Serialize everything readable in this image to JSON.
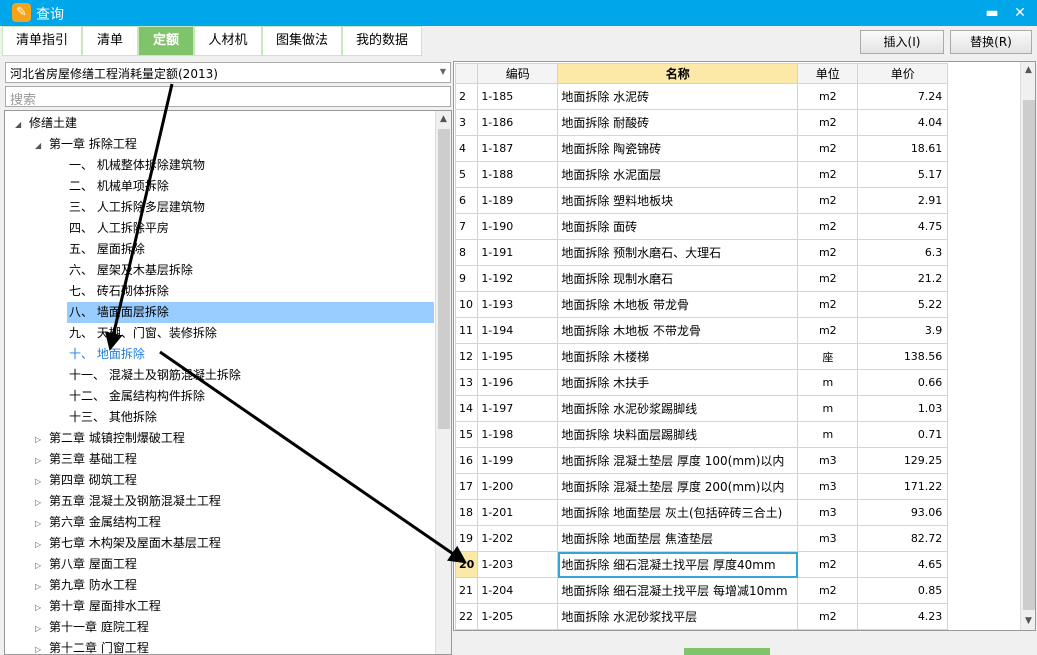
{
  "window": {
    "title": "查询",
    "minimize": "▬",
    "close": "✕"
  },
  "tabs": [
    "清单指引",
    "清单",
    "定额",
    "人材机",
    "图集做法",
    "我的数据"
  ],
  "active_tab": 2,
  "buttons": {
    "insert": "插入(I)",
    "replace": "替换(R)"
  },
  "quota_select": "河北省房屋修缮工程消耗量定额(2013)",
  "search_placeholder": "搜索",
  "tree": {
    "root": "修缮土建",
    "chapter1": "第一章 拆除工程",
    "sections": [
      "一、 机械整体拆除建筑物",
      "二、 机械单项拆除",
      "三、 人工拆除多层建筑物",
      "四、 人工拆除平房",
      "五、 屋面拆除",
      "六、 屋架及木基层拆除",
      "七、 砖石砌体拆除",
      "八、 墙面面层拆除",
      "九、 天棚、门窗、装修拆除",
      "十、 地面拆除",
      "十一、 混凝土及钢筋混凝土拆除",
      "十二、 金属结构构件拆除",
      "十三、 其他拆除"
    ],
    "selected_section": 7,
    "highlighted_section": 9,
    "chapters": [
      "第二章 城镇控制爆破工程",
      "第三章 基础工程",
      "第四章 砌筑工程",
      "第五章 混凝土及钢筋混凝土工程",
      "第六章 金属结构工程",
      "第七章 木构架及屋面木基层工程",
      "第八章 屋面工程",
      "第九章 防水工程",
      "第十章 屋面排水工程",
      "第十一章 庭院工程",
      "第十二章 门窗工程"
    ]
  },
  "grid": {
    "headers": [
      "",
      "编码",
      "名称",
      "单位",
      "单价"
    ],
    "current_row": 20,
    "rows": [
      [
        "2",
        "1-185",
        "地面拆除 水泥砖",
        "m2",
        "7.24"
      ],
      [
        "3",
        "1-186",
        "地面拆除 耐酸砖",
        "m2",
        "4.04"
      ],
      [
        "4",
        "1-187",
        "地面拆除 陶瓷锦砖",
        "m2",
        "18.61"
      ],
      [
        "5",
        "1-188",
        "地面拆除 水泥面层",
        "m2",
        "5.17"
      ],
      [
        "6",
        "1-189",
        "地面拆除 塑料地板块",
        "m2",
        "2.91"
      ],
      [
        "7",
        "1-190",
        "地面拆除 面砖",
        "m2",
        "4.75"
      ],
      [
        "8",
        "1-191",
        "地面拆除 预制水磨石、大理石",
        "m2",
        "6.3"
      ],
      [
        "9",
        "1-192",
        "地面拆除 现制水磨石",
        "m2",
        "21.2"
      ],
      [
        "10",
        "1-193",
        "地面拆除 木地板 带龙骨",
        "m2",
        "5.22"
      ],
      [
        "11",
        "1-194",
        "地面拆除 木地板 不带龙骨",
        "m2",
        "3.9"
      ],
      [
        "12",
        "1-195",
        "地面拆除 木楼梯",
        "座",
        "138.56"
      ],
      [
        "13",
        "1-196",
        "地面拆除 木扶手",
        "m",
        "0.66"
      ],
      [
        "14",
        "1-197",
        "地面拆除 水泥砂浆踢脚线",
        "m",
        "1.03"
      ],
      [
        "15",
        "1-198",
        "地面拆除 块料面层踢脚线",
        "m",
        "0.71"
      ],
      [
        "16",
        "1-199",
        "地面拆除 混凝土垫层 厚度 100(mm)以内",
        "m3",
        "129.25"
      ],
      [
        "17",
        "1-200",
        "地面拆除 混凝土垫层 厚度 200(mm)以内",
        "m3",
        "171.22"
      ],
      [
        "18",
        "1-201",
        "地面拆除 地面垫层 灰土(包括碎砖三合土)",
        "m3",
        "93.06"
      ],
      [
        "19",
        "1-202",
        "地面拆除 地面垫层 焦渣垫层",
        "m3",
        "82.72"
      ],
      [
        "20",
        "1-203",
        "地面拆除 细石混凝土找平层 厚度40mm",
        "m2",
        "4.65"
      ],
      [
        "21",
        "1-204",
        "地面拆除 细石混凝土找平层 每增减10mm",
        "m2",
        "0.85"
      ],
      [
        "22",
        "1-205",
        "地面拆除 水泥砂浆找平层",
        "m2",
        "4.23"
      ]
    ]
  }
}
